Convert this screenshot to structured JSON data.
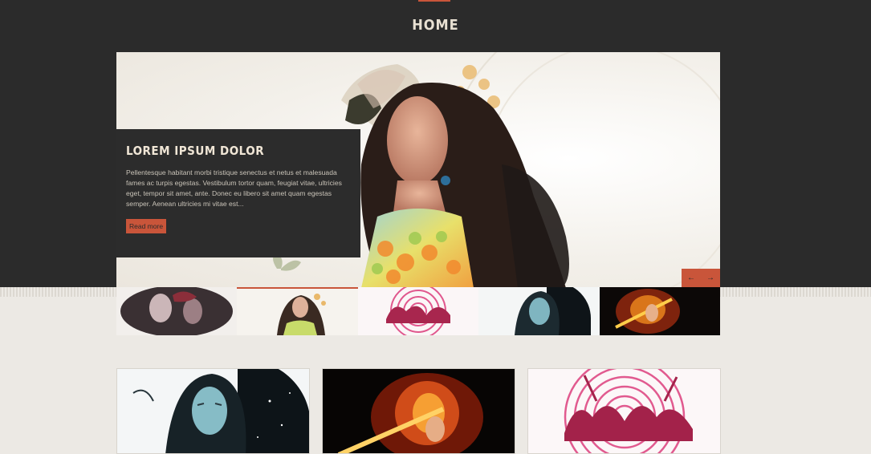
{
  "nav": {
    "home_label": "HOME"
  },
  "slide": {
    "title": "LOREM IPSUM DOLOR",
    "text": "Pellentesque habitant morbi tristique senectus et netus et malesuada fames ac turpis egestas. Vestibulum tortor quam, feugiat vitae, ultricies eget, tempor sit amet, ante. Donec eu libero sit amet quam egestas semper. Aenean ultricies mi vitae est...",
    "read_more": "Read more"
  },
  "slider_controls": {
    "prev": "←",
    "next": "→"
  },
  "thumbnails": [
    {
      "name": "thumb-dark-faces"
    },
    {
      "name": "thumb-woman-flowers"
    },
    {
      "name": "thumb-love-pink"
    },
    {
      "name": "thumb-blue-woman"
    },
    {
      "name": "thumb-fire-woman"
    }
  ],
  "cards": [
    {
      "name": "card-blue-woman"
    },
    {
      "name": "card-fire-woman"
    },
    {
      "name": "card-love-pink"
    }
  ],
  "colors": {
    "accent": "#c9553a",
    "dark": "#2b2b2b",
    "paper": "#ece9e4"
  }
}
